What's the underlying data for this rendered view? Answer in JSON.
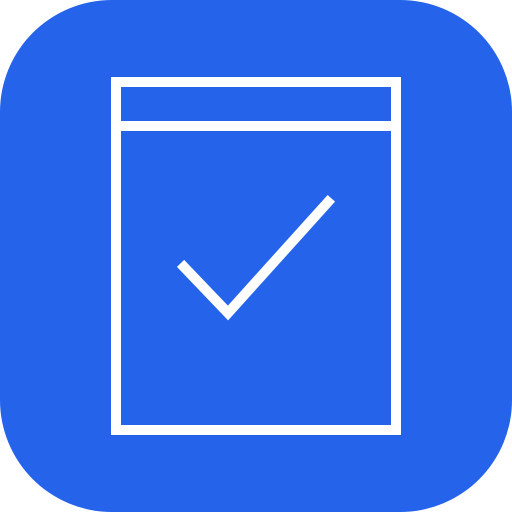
{
  "icon": {
    "name": "checklist-document-icon",
    "background_color": "#2563eb",
    "stroke_color": "#ffffff",
    "content": "document-with-checkmark"
  }
}
